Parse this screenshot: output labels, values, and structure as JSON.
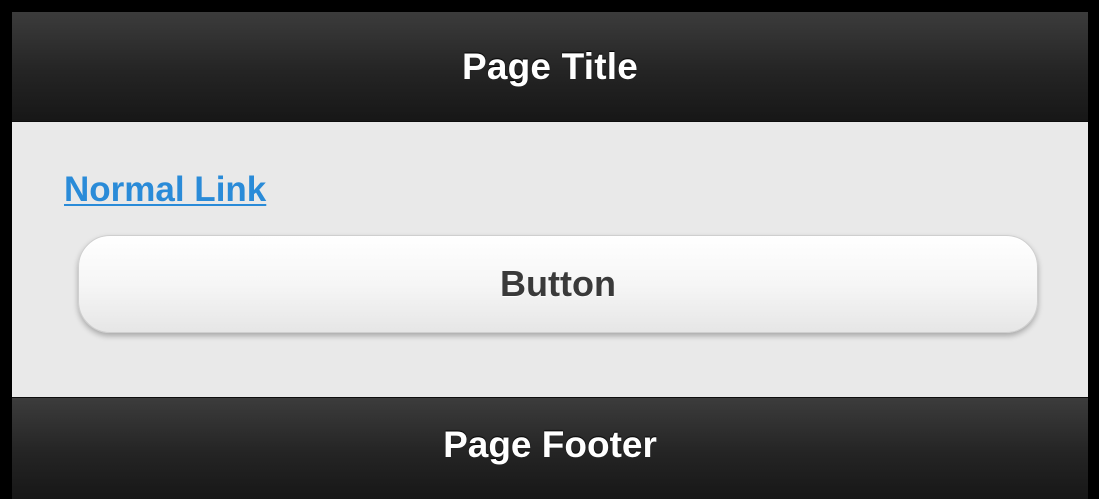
{
  "header": {
    "title": "Page Title"
  },
  "content": {
    "link_label": "Normal Link",
    "button_label": "Button"
  },
  "footer": {
    "title": "Page Footer"
  },
  "colors": {
    "bar_background": "#242424",
    "content_background": "#e9e9e9",
    "link": "#2a8bd8",
    "button_text": "#3a3a3a",
    "outer_frame": "#000000"
  }
}
